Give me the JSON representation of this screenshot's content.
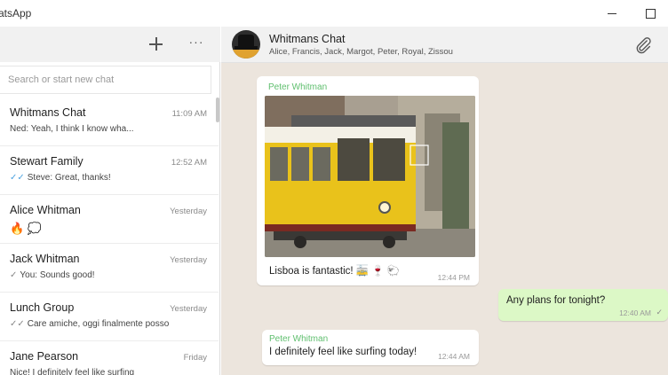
{
  "window": {
    "title": "atsApp",
    "minimize_glyph": "minimize",
    "maximize_glyph": "maximize"
  },
  "sidebar": {
    "new_chat_icon": "plus-icon",
    "more_icon": "more-icon",
    "more_label": "···",
    "search_placeholder": "Search or start new chat",
    "chats": [
      {
        "name": "Whitmans Chat",
        "time": "11:09 AM",
        "preview": "Ned: Yeah, I think I know wha...",
        "tick": ""
      },
      {
        "name": "Stewart Family",
        "time": "12:52 AM",
        "preview": "Steve: Great, thanks!",
        "tick": "✓✓"
      },
      {
        "name": "Alice Whitman",
        "time": "Yesterday",
        "preview": "🔥 💭",
        "tick": ""
      },
      {
        "name": "Jack Whitman",
        "time": "Yesterday",
        "preview": "You: Sounds good!",
        "tick": "✓"
      },
      {
        "name": "Lunch Group",
        "time": "Yesterday",
        "preview": "Care amiche, oggi finalmente posso",
        "tick": "✓✓"
      },
      {
        "name": "Jane Pearson",
        "time": "Friday",
        "preview": "Nice! I definitely feel like surfing",
        "tick": ""
      }
    ]
  },
  "header": {
    "group_name": "Whitmans Chat",
    "members": "Alice, Francis, Jack, Margot, Peter, Royal, Zissou",
    "attach_icon": "paperclip-icon"
  },
  "messages": {
    "photo": {
      "sender": "Peter Whitman",
      "caption": "Lisboa is fantastic! 🚋 🍷 🐑",
      "time": "12:44 PM"
    },
    "outgoing": {
      "text": "Any plans for tonight?",
      "time": "12:40 AM",
      "tick": "✓"
    },
    "bottom": {
      "sender": "Peter Whitman",
      "text": "I definitely feel like surfing today!",
      "time": "12:44 AM"
    }
  },
  "colors": {
    "sender_green": "#5fbf6e",
    "outgoing_bubble": "#dcf8c6",
    "chat_background": "#ece5dd",
    "read_tick_blue": "#4fa3e0"
  }
}
